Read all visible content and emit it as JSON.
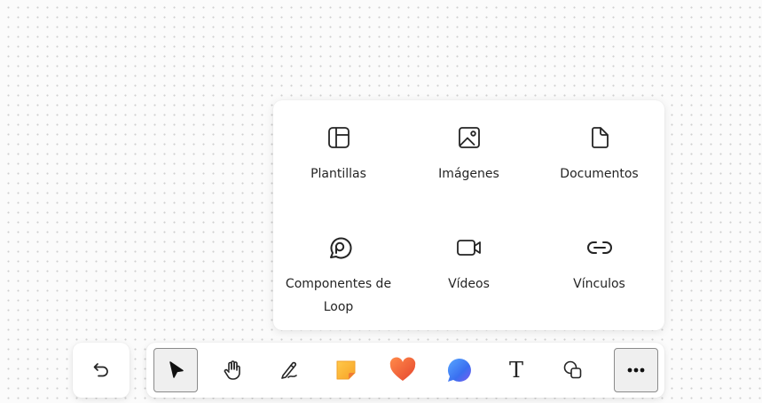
{
  "insert_menu": {
    "items": [
      {
        "label": "Plantillas",
        "icon": "template-icon"
      },
      {
        "label": "Imágenes",
        "icon": "image-icon"
      },
      {
        "label": "Documentos",
        "icon": "document-icon"
      },
      {
        "label": "Componentes de Loop",
        "icon": "loop-icon"
      },
      {
        "label": "Vídeos",
        "icon": "video-icon"
      },
      {
        "label": "Vínculos",
        "icon": "link-icon"
      }
    ]
  },
  "toolbar": {
    "undo_icon": "undo-icon",
    "tools": [
      {
        "name": "select",
        "icon": "pointer-icon",
        "active": true
      },
      {
        "name": "pan",
        "icon": "hand-icon"
      },
      {
        "name": "ink",
        "icon": "pen-icon"
      },
      {
        "name": "sticky-note",
        "icon": "sticky-note-icon",
        "color": "#f9b233"
      },
      {
        "name": "reaction",
        "icon": "heart-icon",
        "color": "#f4633a"
      },
      {
        "name": "comment",
        "icon": "comment-icon",
        "color": "#3b7df0"
      },
      {
        "name": "text",
        "icon": "text-icon",
        "glyph": "T"
      },
      {
        "name": "shapes",
        "icon": "shapes-icon"
      },
      {
        "name": "more",
        "icon": "more-icon",
        "active": true
      }
    ]
  }
}
